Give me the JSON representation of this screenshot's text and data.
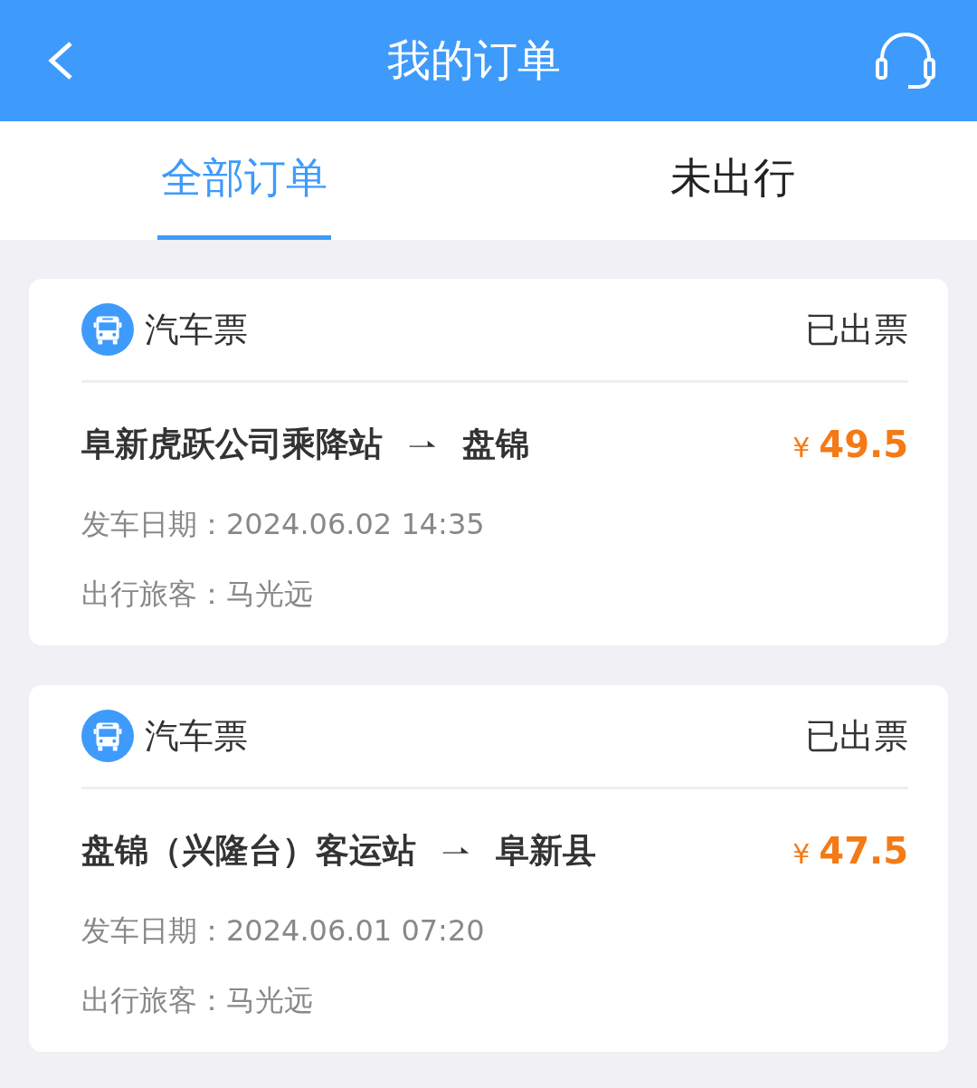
{
  "header": {
    "title": "我的订单"
  },
  "tabs": [
    {
      "label": "全部订单",
      "selected": true
    },
    {
      "label": "未出行",
      "selected": false
    }
  ],
  "orders": [
    {
      "type": "汽车票",
      "status": "已出票",
      "from": "阜新虎跃公司乘降站",
      "to": "盘锦",
      "price": {
        "currency": "¥",
        "amount": "49.5"
      },
      "date": "发车日期：2024.06.02 14:35",
      "passenger": "出行旅客：马光远"
    },
    {
      "type": "汽车票",
      "status": "已出票",
      "from": "盘锦（兴隆台）客运站",
      "to": "阜新县",
      "price": {
        "currency": "¥",
        "amount": "47.5"
      },
      "date": "发车日期：2024.06.01 07:20",
      "passenger": "出行旅客：马光远"
    }
  ]
}
